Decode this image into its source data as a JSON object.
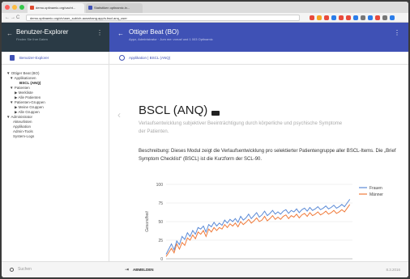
{
  "browser": {
    "tabs": [
      {
        "label": "demo.optinamic.org/vacht..."
      },
      {
        "label": "Statistiken optinamic.in..."
      }
    ],
    "url": "demo.optinamic.org/ch/user_sub/ch-auswhang.app/s.bscl.anq_user",
    "nav": {
      "back": "←",
      "forward": "→",
      "reload": "C",
      "home": "⌂"
    },
    "extension_colors": [
      "#e84a3c",
      "#f5a623",
      "#e84a3c",
      "#2b7de9",
      "#e84a3c",
      "#e84a3c",
      "#2b7de9",
      "#777777",
      "#2b7de9",
      "#e84a3c",
      "#777777",
      "#2b7de9"
    ]
  },
  "sidebar": {
    "title": "Benutzer-Explorer",
    "subtitle": "Finden Sie Ihre Daten",
    "breadcrumb": "Benutzer-Explorer",
    "tree": [
      {
        "label": "▼ Ottiger Beat (BO)",
        "bold": false
      },
      {
        "label": "▼ Applikationen",
        "bold": false
      },
      {
        "label": "BSCL (ANQ)",
        "bold": true
      },
      {
        "label": "▼ Patienten",
        "bold": false
      },
      {
        "label": "▶ Merkliste",
        "bold": false
      },
      {
        "label": "▶ Alle Patienten",
        "bold": false
      },
      {
        "label": "▼ Patienten-Gruppen",
        "bold": false
      },
      {
        "label": "▶ Meine Gruppen",
        "bold": false
      },
      {
        "label": "▶ Alle Gruppen",
        "bold": false
      },
      {
        "label": "▼ Administrator",
        "bold": false
      },
      {
        "label": "Akteurlisten",
        "bold": false
      },
      {
        "label": "Applikation",
        "bold": false
      },
      {
        "label": "Admin-Tools",
        "bold": false
      },
      {
        "label": "System-Logs",
        "bold": false
      }
    ],
    "search_placeholder": "Suchen"
  },
  "main": {
    "title": "Ottiger Beat (BO)",
    "subtitle": "Appz, Administrator · Jum me: vorusf und 1 003 Optinamic",
    "breadcrumb": "Applikation | BSCL (ANQ)",
    "page_title": "BSCL (ANQ)",
    "page_subtitle": "Verlaufsentwicklung subjektiver Beeinträchtigung durch körperliche und psychische Symptome der Patienten.",
    "description": "Beschreibung: Dieses Modul zeigt die Verlaufsentwicklung pro selektierter Patientengruppe aller BSCL-Items. Die „Brief Symptom Checklist“ (BSCL) ist die Kurzform der SCL-90."
  },
  "footer": {
    "logout_label": "ABMELDEN",
    "date": "8.3.2016"
  },
  "chart_data": {
    "type": "line",
    "xlabel": "Alter",
    "ylabel": "Gesundheit",
    "xlim": [
      0,
      70
    ],
    "ylim": [
      0,
      100
    ],
    "xticks": [
      0,
      15,
      30,
      45,
      60
    ],
    "yticks": [
      0,
      25,
      50,
      75,
      100
    ],
    "legend_position": "top-right",
    "x": [
      0,
      2,
      3,
      4,
      5,
      6,
      7,
      8,
      9,
      10,
      11,
      12,
      13,
      14,
      15,
      16,
      17,
      18,
      19,
      20,
      21,
      22,
      23,
      24,
      25,
      26,
      27,
      28,
      29,
      30,
      31,
      32,
      33,
      34,
      35,
      36,
      37,
      38,
      39,
      40,
      41,
      42,
      43,
      44,
      45,
      46,
      47,
      48,
      49,
      50,
      51,
      52,
      53,
      54,
      55,
      56,
      57,
      58,
      59,
      60,
      61,
      62,
      63,
      64,
      65,
      66,
      67,
      68,
      69
    ],
    "series": [
      {
        "name": "Frauen",
        "color": "#5b8ad6",
        "values": [
          6,
          20,
          12,
          24,
          19,
          30,
          26,
          35,
          30,
          38,
          33,
          42,
          40,
          44,
          36,
          46,
          43,
          49,
          44,
          48,
          45,
          52,
          48,
          53,
          50,
          54,
          49,
          57,
          52,
          55,
          60,
          54,
          58,
          62,
          56,
          59,
          64,
          58,
          61,
          65,
          60,
          63,
          60,
          64,
          66,
          61,
          65,
          63,
          67,
          62,
          66,
          68,
          64,
          69,
          65,
          67,
          70,
          66,
          68,
          71,
          67,
          69,
          72,
          68,
          70,
          73,
          70,
          75,
          80
        ]
      },
      {
        "name": "Männer",
        "color": "#f07a3a",
        "values": [
          3,
          14,
          8,
          20,
          13,
          22,
          18,
          28,
          25,
          32,
          27,
          36,
          33,
          38,
          30,
          40,
          36,
          42,
          38,
          42,
          40,
          46,
          42,
          47,
          44,
          48,
          43,
          50,
          46,
          49,
          53,
          48,
          51,
          55,
          50,
          52,
          57,
          51,
          54,
          58,
          53,
          56,
          53,
          57,
          59,
          54,
          58,
          56,
          60,
          55,
          59,
          61,
          57,
          62,
          58,
          60,
          63,
          59,
          61,
          64,
          60,
          62,
          65,
          61,
          63,
          66,
          63,
          68,
          73
        ]
      }
    ]
  }
}
